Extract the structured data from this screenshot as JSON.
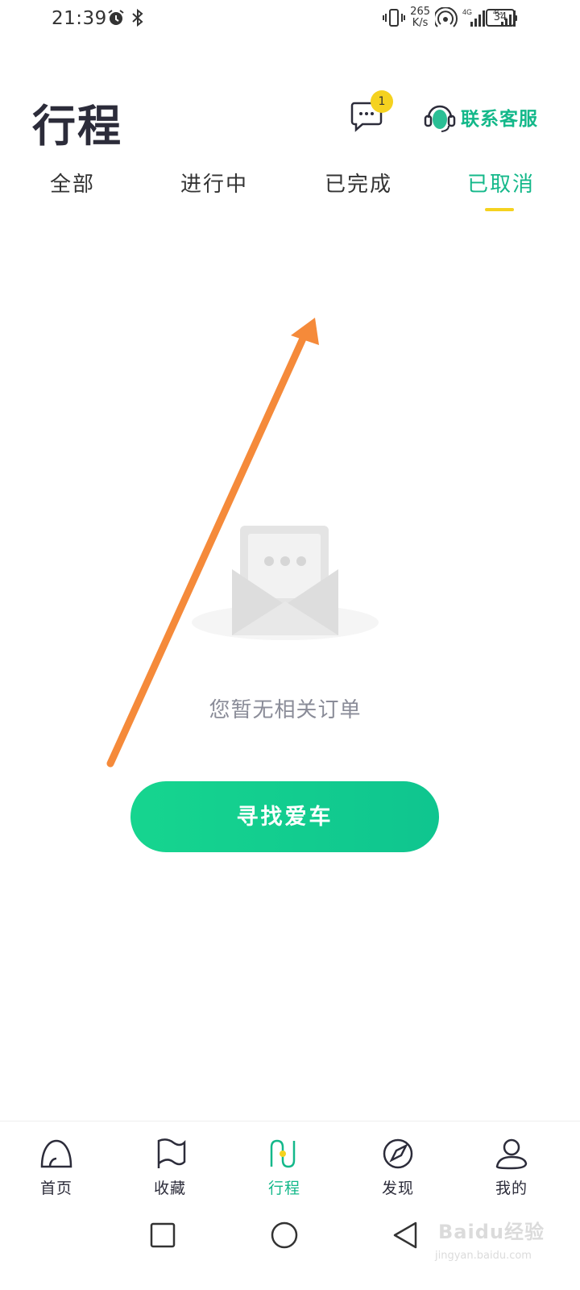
{
  "status_bar": {
    "time": "21:39",
    "netspeed_value": "265",
    "netspeed_unit": "K/s",
    "battery": "34",
    "icons": [
      "alarm-icon",
      "bluetooth-icon",
      "vibrate-icon",
      "hotspot-icon",
      "signal-4g-icon",
      "signal-4g-icon",
      "battery-icon"
    ]
  },
  "header": {
    "title": "行程",
    "message_badge": "1",
    "support_label": "联系客服"
  },
  "tabs": [
    {
      "label": "全部",
      "active": false
    },
    {
      "label": "进行中",
      "active": false
    },
    {
      "label": "已完成",
      "active": false
    },
    {
      "label": "已取消",
      "active": true
    }
  ],
  "empty_state": {
    "text": "您暂无相关订单",
    "button_label": "寻找爱车"
  },
  "bottom_nav": [
    {
      "label": "首页",
      "icon": "home-icon",
      "active": false
    },
    {
      "label": "收藏",
      "icon": "flag-icon",
      "active": false
    },
    {
      "label": "行程",
      "icon": "trip-icon",
      "active": true
    },
    {
      "label": "发现",
      "icon": "compass-icon",
      "active": false
    },
    {
      "label": "我的",
      "icon": "profile-icon",
      "active": false
    }
  ],
  "watermark": {
    "text": "Baidu经验",
    "sub": "jingyan.baidu.com"
  },
  "colors": {
    "accent": "#14b88a",
    "button_gradient_start": "#16d58f",
    "button_gradient_end": "#0fc58f",
    "badge": "#f5d21f",
    "annotation_arrow": "#f58a3a"
  }
}
